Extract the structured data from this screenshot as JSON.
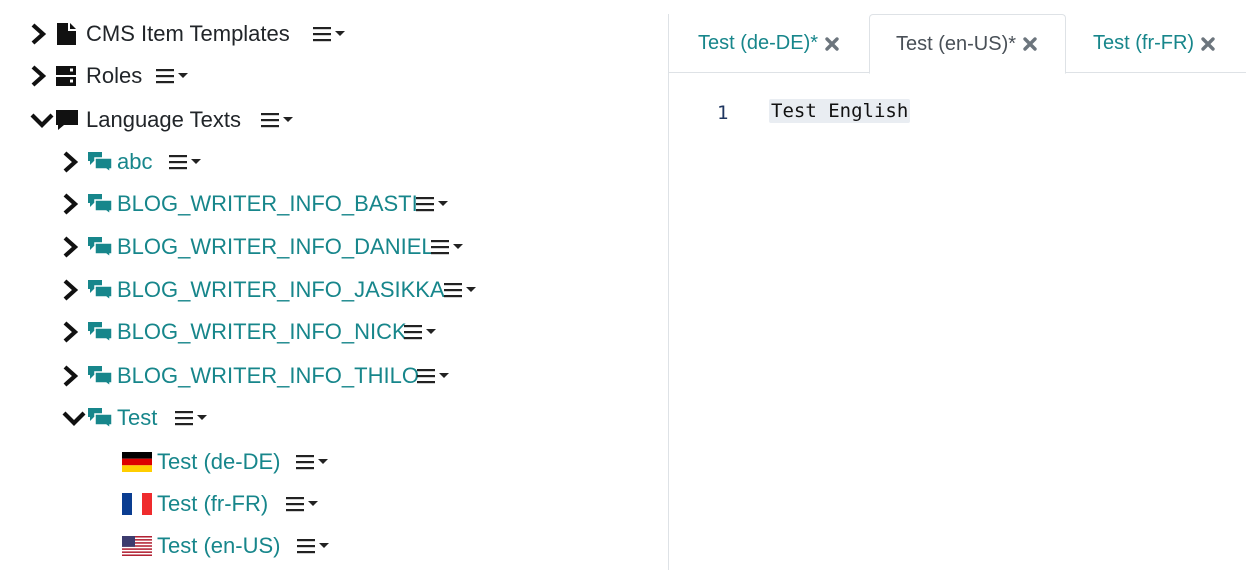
{
  "tree": {
    "cms_item_templates": "CMS Item Templates",
    "roles": "Roles",
    "language_texts": "Language Texts",
    "children": [
      "abc",
      "BLOG_WRITER_INFO_BASTI",
      "BLOG_WRITER_INFO_DANIEL",
      "BLOG_WRITER_INFO_JASIKKA",
      "BLOG_WRITER_INFO_NICK",
      "BLOG_WRITER_INFO_THILO",
      "Test"
    ],
    "test_children": [
      {
        "label": "Test (de-DE)",
        "flag": "flag-germany"
      },
      {
        "label": "Test (fr-FR)",
        "flag": "flag-france"
      },
      {
        "label": "Test (en-US)",
        "flag": "flag-usa"
      }
    ],
    "icons": {
      "expanded": "chevron-down-icon",
      "collapsed": "chevron-right-icon",
      "file": "file-icon",
      "server": "server-icon",
      "comment": "comment-icon",
      "comments": "comments-icon",
      "menu": "hamburger-menu-icon"
    }
  },
  "editor": {
    "tabs": [
      {
        "label": "Test (de-DE)*",
        "active": false
      },
      {
        "label": "Test (en-US)*",
        "active": true
      },
      {
        "label": "Test (fr-FR)",
        "active": false
      }
    ],
    "line_number": "1",
    "code": "Test English"
  },
  "colors": {
    "teal": "#17868b",
    "dark": "#212529",
    "tab_active_text": "#495057",
    "close": "#6c757d",
    "border": "#dee2e6",
    "code_highlight": "#e9edf2",
    "line_number": "#1f3660"
  }
}
